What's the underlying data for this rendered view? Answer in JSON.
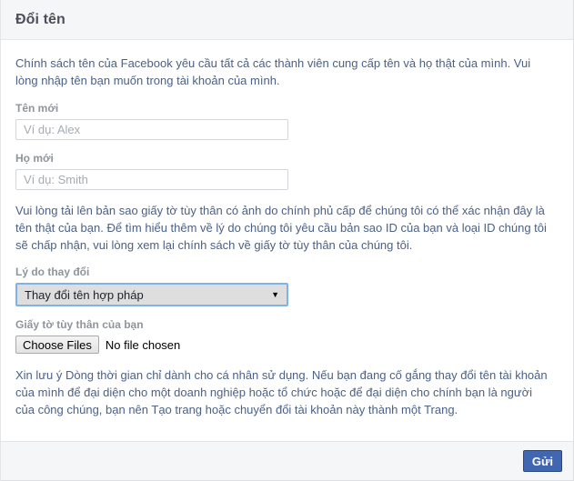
{
  "header": {
    "title": "Đổi tên"
  },
  "body": {
    "intro_paragraph": "Chính sách tên của Facebook yêu cầu tất cả các thành viên cung cấp tên và họ thật của mình. Vui lòng nhập tên bạn muốn trong tài khoản của mình.",
    "first_name": {
      "label": "Tên mới",
      "placeholder": "Ví dụ: Alex",
      "value": ""
    },
    "last_name": {
      "label": "Họ mới",
      "placeholder": "Ví dụ: Smith",
      "value": ""
    },
    "id_paragraph": "Vui lòng tải lên bản sao giấy tờ tùy thân có ảnh do chính phủ cấp để chúng tôi có thể xác nhận đây là tên thật của bạn. Để tìm hiểu thêm về lý do chúng tôi yêu cầu bản sao ID của bạn và loại ID chúng tôi sẽ chấp nhận, vui lòng xem lại chính sách về giấy tờ tùy thân của chúng tôi.",
    "reason": {
      "label": "Lý do thay đổi",
      "selected": "Thay đổi tên hợp pháp",
      "arrow_glyph": "▼"
    },
    "upload": {
      "label": "Giấy tờ tùy thân của bạn",
      "button_label": "Choose Files",
      "status_text": "No file chosen"
    },
    "note_paragraph": "Xin lưu ý Dòng thời gian chỉ dành cho cá nhân sử dụng. Nếu bạn đang cố gắng thay đổi tên tài khoản của mình để đại diện cho một doanh nghiệp hoặc tổ chức hoặc để đại diện cho chính bạn là người của công chúng, bạn nên Tạo trang hoặc chuyển đổi tài khoản này thành một Trang."
  },
  "footer": {
    "submit_label": "Gửi"
  },
  "colors": {
    "brand_blue": "#4267b2",
    "brand_blue_border": "#29487d",
    "text_body": "#4b6186",
    "label_gray": "#90949c",
    "header_bg": "#f5f6f7",
    "focus_blue": "#7eb3e8"
  }
}
